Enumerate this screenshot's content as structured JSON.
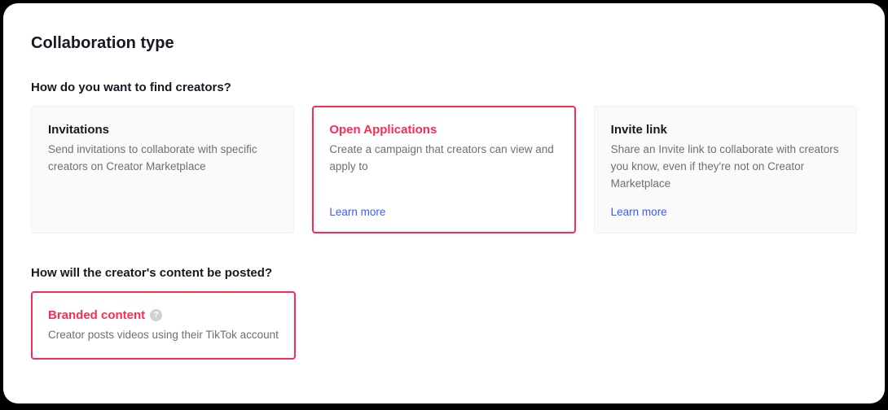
{
  "title": "Collaboration type",
  "section1": {
    "heading": "How do you want to find creators?",
    "cards": [
      {
        "title": "Invitations",
        "desc": "Send invitations to collaborate with specific creators on Creator Marketplace"
      },
      {
        "title": "Open Applications",
        "desc": "Create a campaign that creators can view and apply to",
        "learn_more": "Learn more"
      },
      {
        "title": "Invite link",
        "desc": "Share an Invite link to collaborate with creators you know, even if they're not on Creator Marketplace",
        "learn_more": "Learn more"
      }
    ]
  },
  "section2": {
    "heading": "How will the creator's content be posted?",
    "cards": [
      {
        "title": "Branded content",
        "desc": "Creator posts videos using their TikTok account"
      }
    ]
  }
}
